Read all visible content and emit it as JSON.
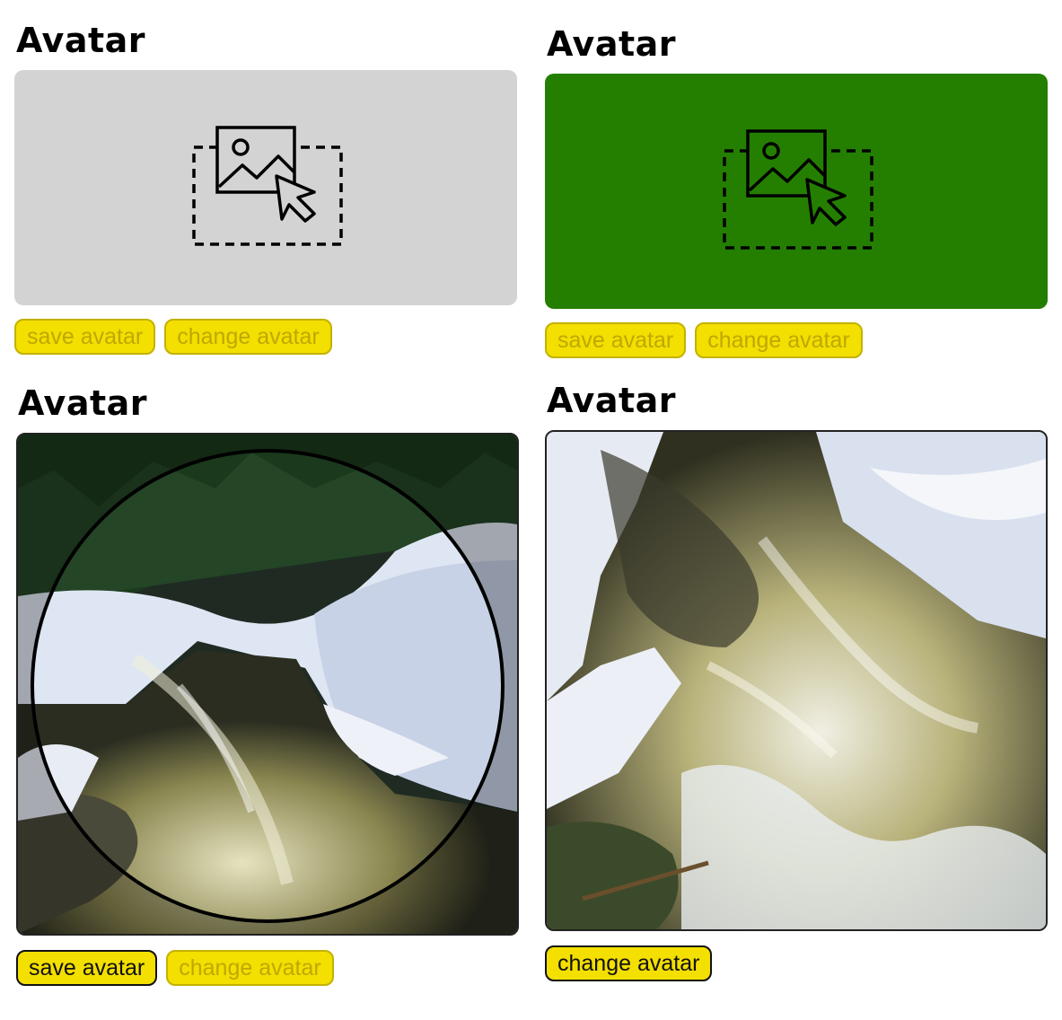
{
  "panels": [
    {
      "heading": "Avatar",
      "state": "empty",
      "dropzone_color": "#d3d3d3",
      "buttons": [
        {
          "label": "save avatar",
          "enabled": false
        },
        {
          "label": "change avatar",
          "enabled": false
        }
      ]
    },
    {
      "heading": "Avatar",
      "state": "hover",
      "dropzone_color": "#247f00",
      "buttons": [
        {
          "label": "save avatar",
          "enabled": false
        },
        {
          "label": "change avatar",
          "enabled": false
        }
      ]
    },
    {
      "heading": "Avatar",
      "state": "cropping",
      "image": "river-rapids-snow-photo",
      "buttons": [
        {
          "label": "save avatar",
          "enabled": true
        },
        {
          "label": "change avatar",
          "enabled": false
        }
      ]
    },
    {
      "heading": "Avatar",
      "state": "saved",
      "image": "river-rapids-snow-photo",
      "buttons": [
        {
          "label": "change avatar",
          "enabled": true
        }
      ]
    }
  ],
  "icon": "image-upload-drop-icon",
  "colors": {
    "button_bg": "#f3df00",
    "button_disabled_text": "#bfa800",
    "button_active_border": "#111111"
  }
}
